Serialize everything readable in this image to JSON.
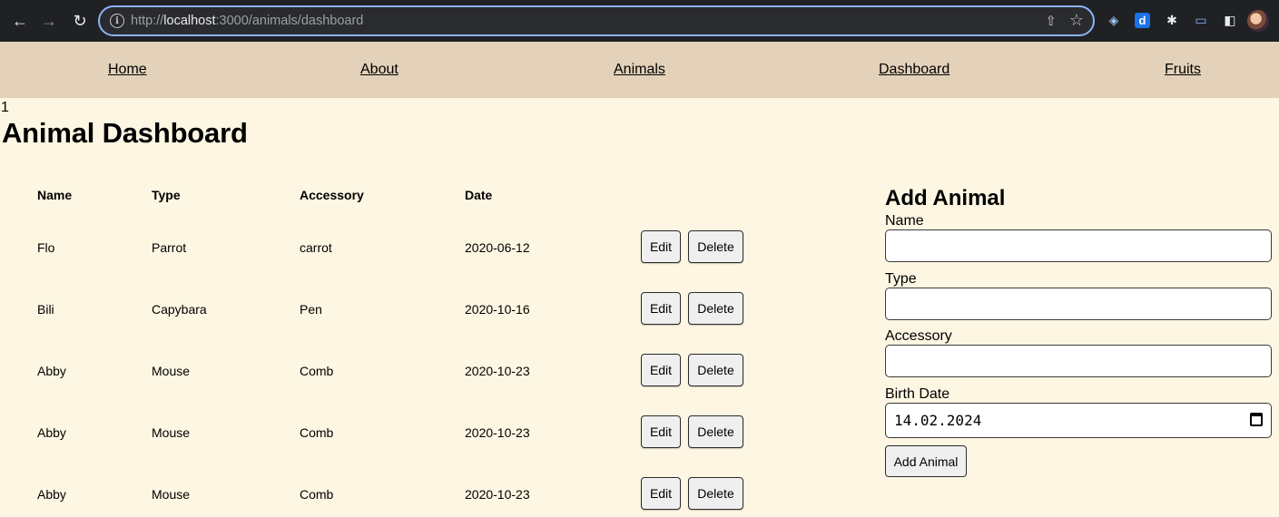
{
  "browser": {
    "url_scheme": "http://",
    "url_host": "localhost",
    "url_path": ":3000/animals/dashboard"
  },
  "nav": {
    "home": "Home",
    "about": "About",
    "animals": "Animals",
    "dashboard": "Dashboard",
    "fruits": "Fruits"
  },
  "page": {
    "counter": "1",
    "title": "Animal Dashboard"
  },
  "table": {
    "headers": [
      "Name",
      "Type",
      "Accessory",
      "Date"
    ],
    "rows": [
      {
        "name": "Flo",
        "type": "Parrot",
        "accessory": "carrot",
        "date": "2020-06-12"
      },
      {
        "name": "Bili",
        "type": "Capybara",
        "accessory": "Pen",
        "date": "2020-10-16"
      },
      {
        "name": "Abby",
        "type": "Mouse",
        "accessory": "Comb",
        "date": "2020-10-23"
      },
      {
        "name": "Abby",
        "type": "Mouse",
        "accessory": "Comb",
        "date": "2020-10-23"
      },
      {
        "name": "Abby",
        "type": "Mouse",
        "accessory": "Comb",
        "date": "2020-10-23"
      }
    ],
    "edit_label": "Edit",
    "delete_label": "Delete"
  },
  "form": {
    "title": "Add Animal",
    "name_label": "Name",
    "type_label": "Type",
    "accessory_label": "Accessory",
    "birth_label": "Birth Date",
    "birth_value": "14.02.2024",
    "submit_label": "Add Animal"
  },
  "colors": {
    "page_bg": "#fdf6e2",
    "nav_bg": "#e3d2b9"
  }
}
